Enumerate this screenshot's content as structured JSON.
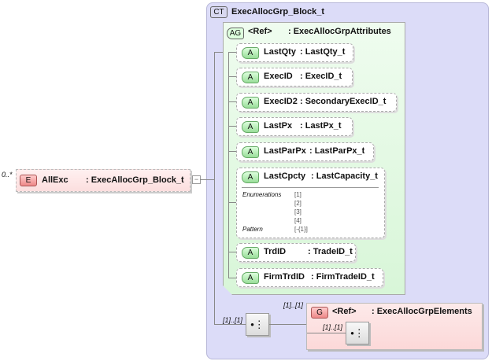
{
  "element": {
    "cardinality": "0..*",
    "badge": "E",
    "name": "AllExc",
    "type": ": ExecAllocGrp_Block_t",
    "collapse": "−"
  },
  "complex_type": {
    "badge": "CT",
    "name": "ExecAllocGrp_Block_t"
  },
  "attribute_group": {
    "badge": "AG",
    "name": "<Ref>",
    "type": ": ExecAllocGrpAttributes"
  },
  "attributes": [
    {
      "badge": "A",
      "name": "LastQty",
      "type": ": LastQty_t"
    },
    {
      "badge": "A",
      "name": "ExecID",
      "type": ": ExecID_t"
    },
    {
      "badge": "A",
      "name": "ExecID2",
      "type": ": SecondaryExecID_t"
    },
    {
      "badge": "A",
      "name": "LastPx",
      "type": ": LastPx_t"
    },
    {
      "badge": "A",
      "name": "LastParPx",
      "type": ": LastParPx_t"
    },
    {
      "badge": "A",
      "name": "LastCpcty",
      "type": ": LastCapacity_t",
      "enum_label": "Enumerations",
      "enums": [
        "[1]",
        "[2]",
        "[3]",
        "[4]"
      ],
      "pattern_label": "Pattern",
      "pattern": "[-{1}]"
    },
    {
      "badge": "A",
      "name": "TrdID",
      "type": ": TradeID_t"
    },
    {
      "badge": "A",
      "name": "FirmTrdID",
      "type": ": FirmTradeID_t"
    }
  ],
  "sequence": {
    "cardinality": "[1]..[1]",
    "icon": "sequence-icon"
  },
  "group": {
    "cardinality": "[1]..[1]",
    "badge": "G",
    "name": "<Ref>",
    "type": ": ExecAllocGrpElements",
    "inner_cardinality": "[1]..[1]"
  }
}
